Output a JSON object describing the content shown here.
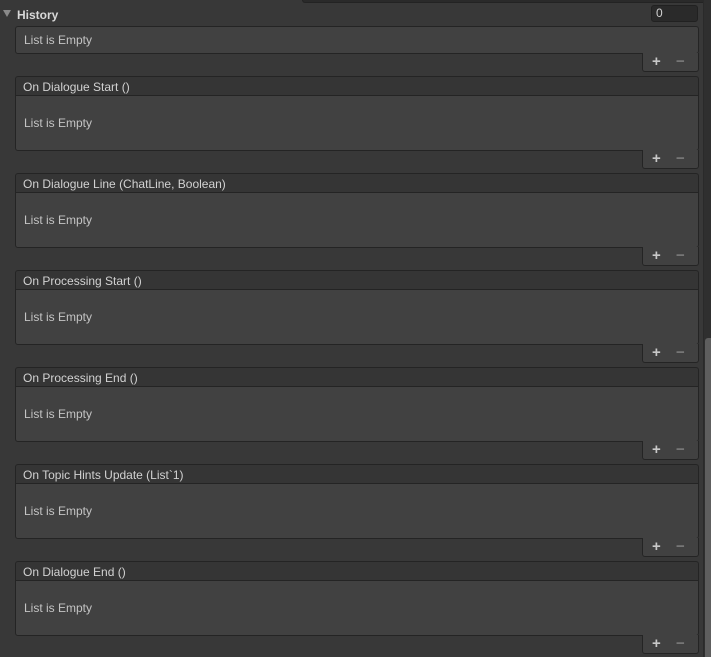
{
  "history": {
    "label": "History",
    "size_value": "0",
    "empty_text": "List is Empty",
    "add_label": "+",
    "remove_label": "−"
  },
  "events": [
    {
      "title": "On Dialogue Start ()",
      "empty_text": "List is Empty",
      "add_label": "+",
      "remove_label": "−"
    },
    {
      "title": "On Dialogue Line (ChatLine, Boolean)",
      "empty_text": "List is Empty",
      "add_label": "+",
      "remove_label": "−"
    },
    {
      "title": "On Processing Start ()",
      "empty_text": "List is Empty",
      "add_label": "+",
      "remove_label": "−"
    },
    {
      "title": "On Processing End ()",
      "empty_text": "List is Empty",
      "add_label": "+",
      "remove_label": "−"
    },
    {
      "title": "On Topic Hints Update (List`1)",
      "empty_text": "List is Empty",
      "add_label": "+",
      "remove_label": "−"
    },
    {
      "title": "On Dialogue End ()",
      "empty_text": "List is Empty",
      "add_label": "+",
      "remove_label": "−"
    }
  ]
}
